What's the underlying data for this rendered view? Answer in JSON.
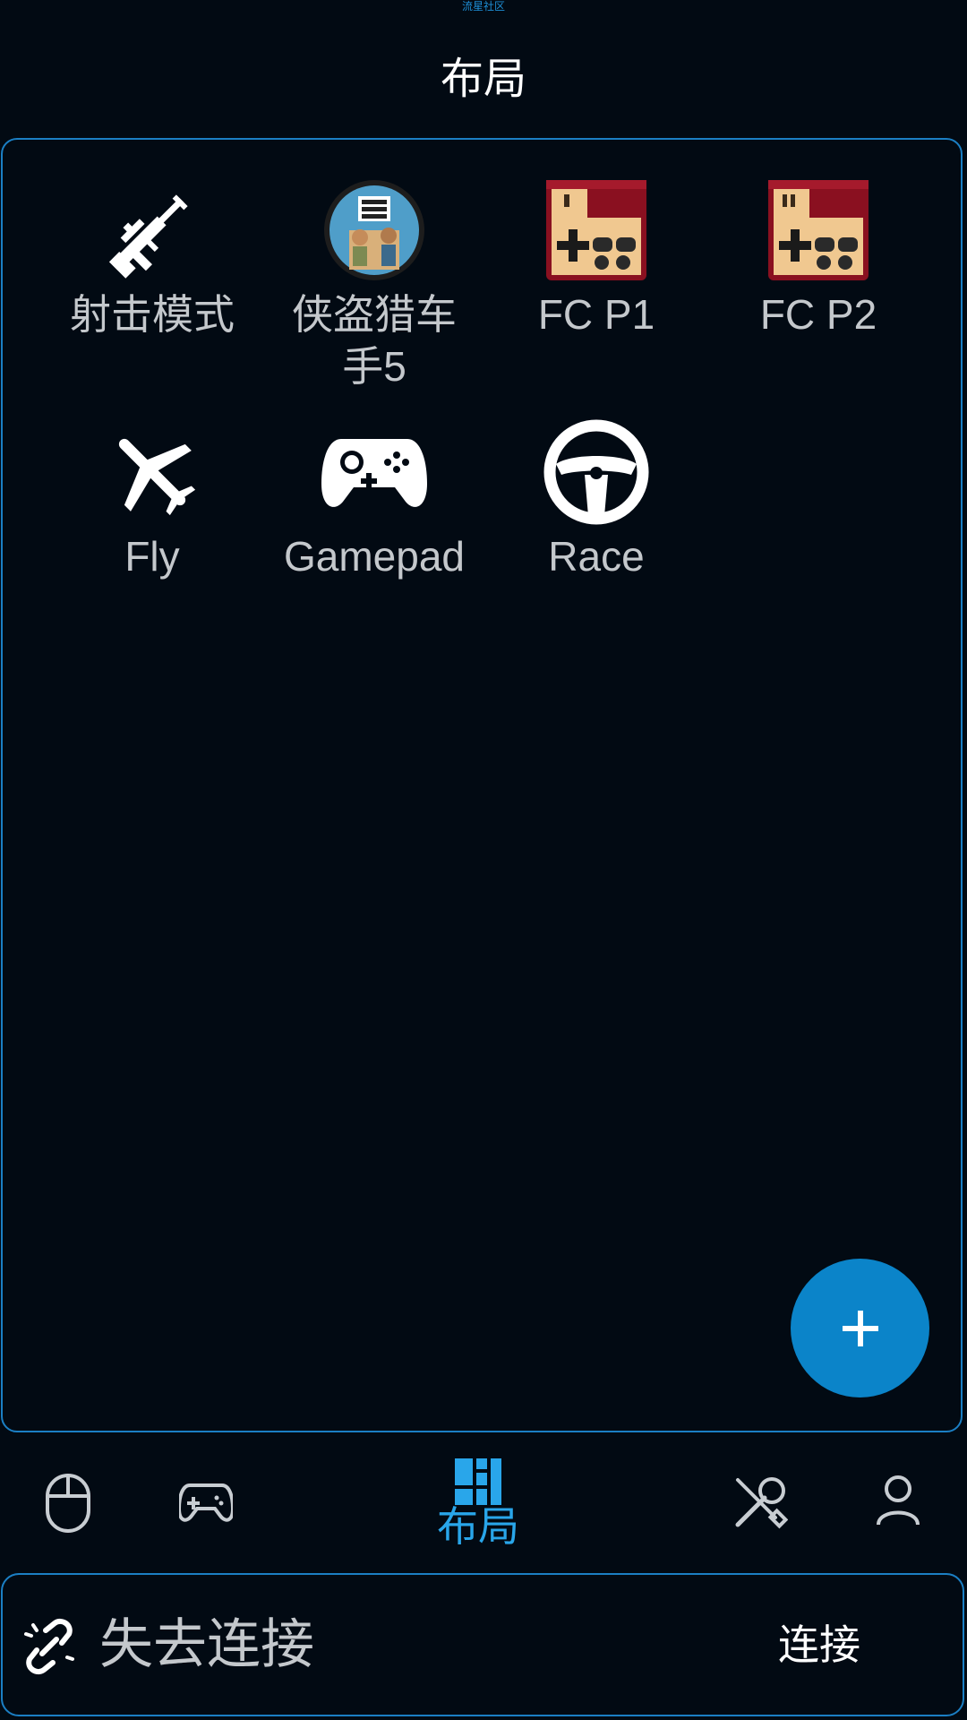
{
  "watermark": "流星社区",
  "header": {
    "title": "布局"
  },
  "layouts": [
    {
      "label": "射击模式",
      "icon": "sniper-rifle-icon"
    },
    {
      "label": "侠盗猎车手5",
      "icon": "gta5-logo-icon"
    },
    {
      "label": "FC P1",
      "icon": "fc-controller-1-icon"
    },
    {
      "label": "FC P2",
      "icon": "fc-controller-2-icon"
    },
    {
      "label": "Fly",
      "icon": "airplane-icon"
    },
    {
      "label": "Gamepad",
      "icon": "gamepad-icon"
    },
    {
      "label": "Race",
      "icon": "steering-wheel-icon"
    }
  ],
  "fab": {
    "icon": "plus-icon",
    "color": "#0b84c9"
  },
  "bottom_nav": {
    "items": [
      {
        "icon": "mouse-icon"
      },
      {
        "icon": "gamepad-icon"
      },
      {
        "icon": "layout-icon",
        "label": "布局",
        "active": true
      },
      {
        "icon": "tools-icon"
      },
      {
        "icon": "user-icon"
      }
    ]
  },
  "status": {
    "icon": "broken-link-icon",
    "text": "失去连接",
    "connect_label": "连接"
  },
  "colors": {
    "accent": "#29a6ea",
    "border": "#1b7fc4",
    "background": "#020a13"
  }
}
